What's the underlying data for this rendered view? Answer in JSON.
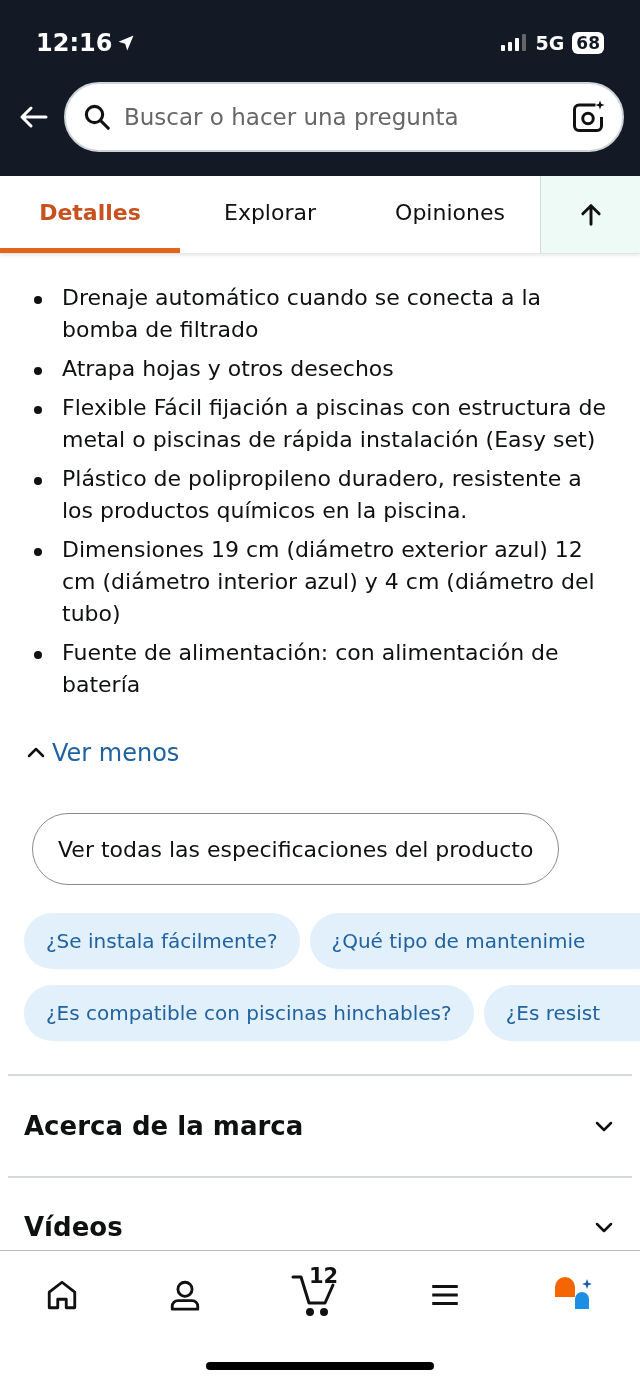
{
  "status_bar": {
    "time": "12:16",
    "network": "5G",
    "battery": "68"
  },
  "search": {
    "placeholder": "Buscar o hacer una pregunta"
  },
  "tabs": [
    {
      "label": "Detalles",
      "selected": true
    },
    {
      "label": "Explorar",
      "selected": false
    },
    {
      "label": "Opiniones",
      "selected": false
    }
  ],
  "bullets": [
    "Drenaje automático cuando se conecta a la bomba de filtrado",
    "Atrapa hojas y otros desechos",
    "Flexible Fácil fijación a piscinas con estructura de metal o piscinas de rápida instalación (Easy set)",
    "Plástico de polipropileno duradero, resistente a los productos químicos en la piscina.",
    "Dimensiones 19 cm (diámetro exterior azul) 12 cm (diámetro interior azul) y 4 cm (diámetro del tubo)",
    "Fuente de alimentación: con alimentación de batería"
  ],
  "toggle_link": "Ver menos",
  "specs_button": "Ver todas las especificaciones del producto",
  "question_rows": [
    [
      "¿Se instala fácilmente?",
      "¿Qué tipo de mantenimie"
    ],
    [
      "¿Es compatible con piscinas hinchables?",
      "¿Es resist"
    ]
  ],
  "sections": [
    {
      "title": "Acerca de la marca",
      "expanded": false
    },
    {
      "title": "Vídeos",
      "expanded": false
    }
  ],
  "bottom_nav": {
    "cart_count": "12"
  }
}
